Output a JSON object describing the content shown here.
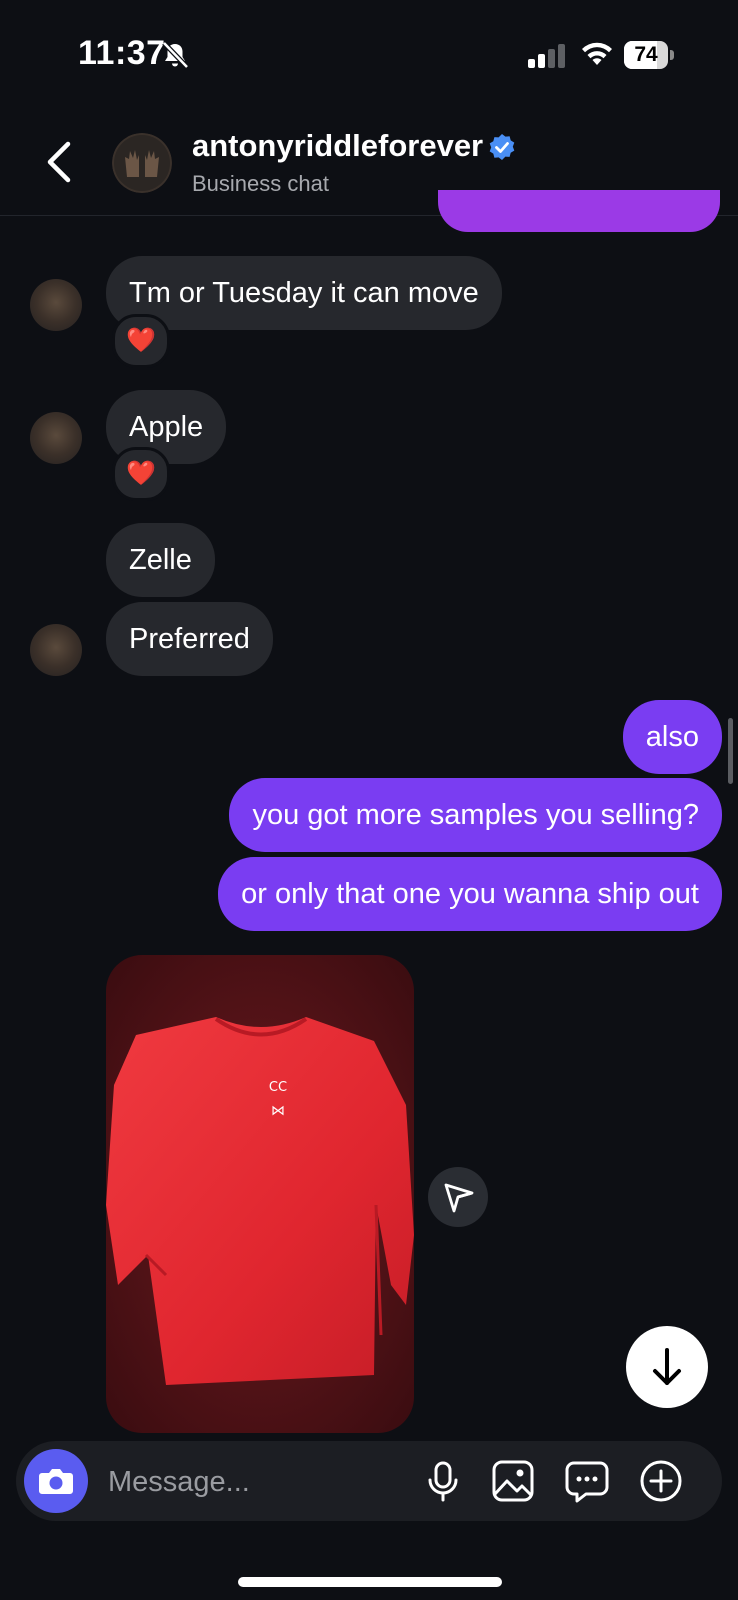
{
  "status_bar": {
    "time": "11:37",
    "battery_percent": "74",
    "battery_level": 0.74,
    "icons": [
      "bell-slash-icon",
      "cellular-signal-icon",
      "wifi-icon",
      "battery-icon"
    ]
  },
  "header": {
    "back_icon": "chevron-left-icon",
    "name": "antonyriddleforever",
    "verified_icon": "verified-badge-icon",
    "subtitle": "Business chat"
  },
  "messages": [
    {
      "from": "them",
      "text": "Tm or Tuesday it can move",
      "reaction": "❤️"
    },
    {
      "from": "them",
      "text": "Apple",
      "reaction": "❤️"
    },
    {
      "from": "them",
      "text": "Zelle"
    },
    {
      "from": "them",
      "text": "Preferred"
    },
    {
      "from": "me",
      "text": "also"
    },
    {
      "from": "me",
      "text": "you got more samples you selling?"
    },
    {
      "from": "me",
      "text": "or only that one you wanna ship out"
    },
    {
      "from": "them",
      "type": "photo",
      "description_icon": "photo-red-shirt"
    }
  ],
  "composer": {
    "placeholder": "Message...",
    "icons": [
      "camera-icon",
      "microphone-icon",
      "gallery-icon",
      "sticker-chat-icon",
      "plus-circle-icon"
    ]
  },
  "colors": {
    "background": "#0d0f14",
    "incoming_bubble": "#26282d",
    "outgoing_bubble": "#7a3df2",
    "camera_button": "#5a5cf0",
    "verified": "#4a8ff5"
  }
}
